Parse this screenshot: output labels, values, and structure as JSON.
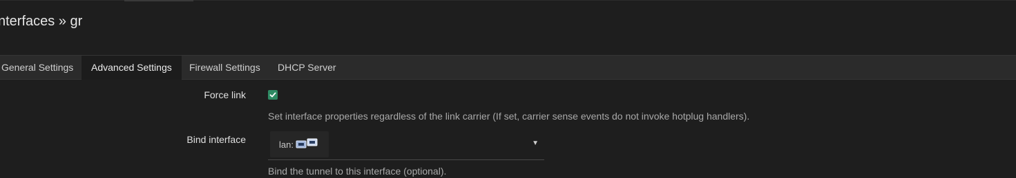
{
  "page": {
    "title": "nterfaces » gr"
  },
  "tabs": [
    {
      "label": "General Settings",
      "active": false
    },
    {
      "label": "Advanced Settings",
      "active": true
    },
    {
      "label": "Firewall Settings",
      "active": false
    },
    {
      "label": "DHCP Server",
      "active": false
    }
  ],
  "form": {
    "force_link": {
      "label": "Force link",
      "checked": true,
      "description": "Set interface properties regardless of the link carrier (If set, carrier sense events do not invoke hotplug handlers)."
    },
    "bind_interface": {
      "label": "Bind interface",
      "selected_value": "lan:",
      "icon": "network-ports-icon",
      "description": "Bind the tunnel to this interface (optional)."
    }
  },
  "colors": {
    "background": "#1e1e1e",
    "tabbar": "#2b2b2b",
    "active_tab": "#1c1c1c",
    "checkbox_accent": "#2e8a63"
  }
}
